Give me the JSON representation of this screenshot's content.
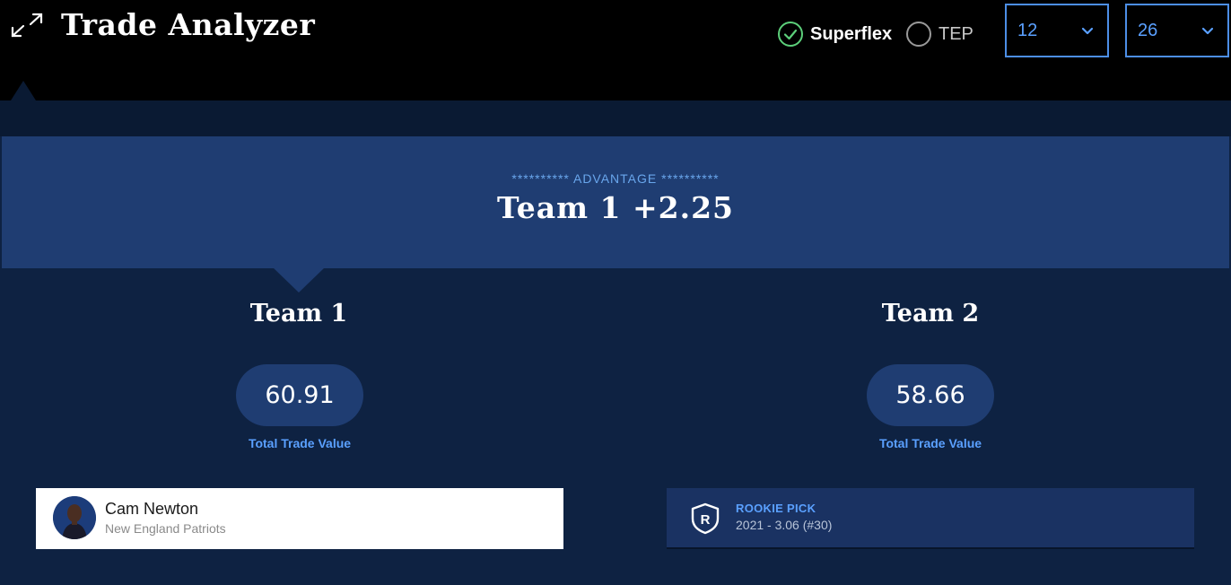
{
  "header": {
    "title": "Trade Analyzer",
    "expand_icon": "expand-arrows-icon",
    "toggles": [
      {
        "label": "Superflex",
        "checked": true
      },
      {
        "label": "TEP",
        "checked": false
      }
    ],
    "selects": [
      {
        "value": "12"
      },
      {
        "value": "26"
      }
    ]
  },
  "advantage": {
    "caption": "********** ADVANTAGE **********",
    "value": "Team 1 +2.25"
  },
  "teams": [
    {
      "name": "Team 1",
      "total_value": "60.91",
      "total_label": "Total Trade Value"
    },
    {
      "name": "Team 2",
      "total_value": "58.66",
      "total_label": "Total Trade Value"
    }
  ],
  "team1_assets": [
    {
      "name": "Cam Newton",
      "team": "New England Patriots"
    }
  ],
  "team2_assets": [
    {
      "type": "ROOKIE PICK",
      "detail": "2021 - 3.06 (#30)",
      "badge_letter": "R"
    }
  ],
  "colors": {
    "page_bg": "#0e2242",
    "band_bg": "#1f3d72",
    "accent_blue": "#5aa0ff",
    "check_green": "#5ccf7a"
  }
}
